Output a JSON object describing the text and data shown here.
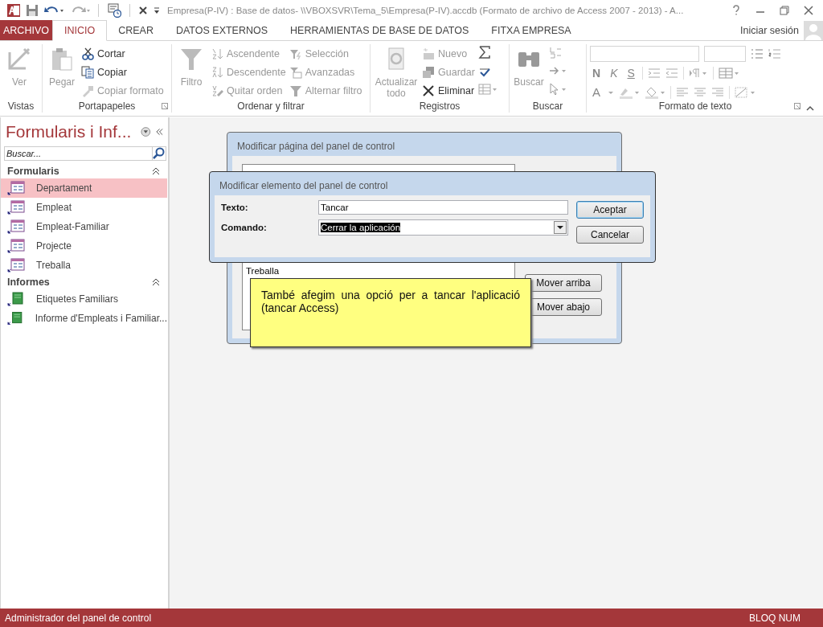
{
  "window": {
    "title": "Empresa(P-IV) : Base de datos- \\\\VBOXSVR\\Tema_5\\Empresa(P-IV).accdb (Formato de archivo de Access 2007 - 2013) - A..."
  },
  "tabs": [
    {
      "label": "ARCHIVO",
      "kind": "file",
      "selected": false
    },
    {
      "label": "INICIO",
      "kind": "tab",
      "selected": true
    },
    {
      "label": "CREAR",
      "kind": "tab",
      "selected": false
    },
    {
      "label": "DATOS EXTERNOS",
      "kind": "tab",
      "selected": false
    },
    {
      "label": "HERRAMIENTAS DE BASE DE DATOS",
      "kind": "tab",
      "selected": false
    },
    {
      "label": "FITXA EMPRESA",
      "kind": "tab",
      "selected": false
    }
  ],
  "account": {
    "label": "Iniciar sesión"
  },
  "ribbon": [
    {
      "label": "Vistas",
      "large": {
        "label": "Ver",
        "disabled": true
      }
    },
    {
      "label": "Portapapeles",
      "large": {
        "label": "Pegar",
        "disabled": true
      },
      "columns": [
        [
          {
            "label": "Cortar",
            "disabled": false
          },
          {
            "label": "Copiar",
            "disabled": false
          },
          {
            "label": "Copiar formato",
            "disabled": true
          }
        ]
      ]
    },
    {
      "label": "Ordenar y filtrar",
      "large": {
        "label": "Filtro",
        "disabled": true
      },
      "columns": [
        [
          {
            "label": "Ascendente",
            "disabled": true
          },
          {
            "label": "Descendente",
            "disabled": true
          },
          {
            "label": "Quitar orden",
            "disabled": true
          }
        ],
        [
          {
            "label": "Selección",
            "disabled": true
          },
          {
            "label": "Avanzadas",
            "disabled": true
          },
          {
            "label": "Alternar filtro",
            "disabled": true
          }
        ]
      ]
    },
    {
      "label": "Registros",
      "large": {
        "label": "Actualizar todo",
        "disabled": true
      },
      "columns": [
        [
          {
            "label": "Nuevo",
            "disabled": true
          },
          {
            "label": "Guardar",
            "disabled": true
          },
          {
            "label": "Eliminar",
            "disabled": false
          }
        ]
      ]
    },
    {
      "label": "Buscar",
      "large": {
        "label": "Buscar",
        "disabled": true
      }
    },
    {
      "label": "Formato de texto",
      "format_letters": [
        "N",
        "K",
        "S",
        "A"
      ]
    }
  ],
  "nav": {
    "title": "Formularis i Inf...",
    "search_placeholder": "Buscar...",
    "groups": [
      {
        "label": "Formularis",
        "items": [
          {
            "label": "Departament",
            "kind": "form",
            "selected": true
          },
          {
            "label": "Empleat",
            "kind": "form",
            "selected": false
          },
          {
            "label": "Empleat-Familiar",
            "kind": "form",
            "selected": false
          },
          {
            "label": "Projecte",
            "kind": "form",
            "selected": false
          },
          {
            "label": "Treballa",
            "kind": "form",
            "selected": false
          }
        ]
      },
      {
        "label": "Informes",
        "items": [
          {
            "label": "Etiquetes Familiars",
            "kind": "report",
            "selected": false
          },
          {
            "label": "Informe d'Empleats i Familiar...",
            "kind": "report",
            "selected": false
          }
        ]
      }
    ]
  },
  "back_dialog": {
    "title": "Modificar página del panel de control",
    "list": [
      "Treballa"
    ],
    "buttons": [
      "Mover arriba",
      "Mover abajo"
    ]
  },
  "front_dialog": {
    "title": "Modificar elemento del panel de control",
    "text_label": "Texto:",
    "text_value": "Tancar",
    "command_label": "Comando:",
    "command_value": "Cerrar la aplicación",
    "command_highlighted": true,
    "buttons": [
      {
        "label": "Aceptar",
        "default": true
      },
      {
        "label": "Cancelar",
        "default": false
      }
    ]
  },
  "callout": {
    "text": "També afegim una opció per a tancar l'aplicació (tancar Access)"
  },
  "status_bar": {
    "left": "Administrador del panel de control",
    "right": "BLOQ NUM"
  }
}
